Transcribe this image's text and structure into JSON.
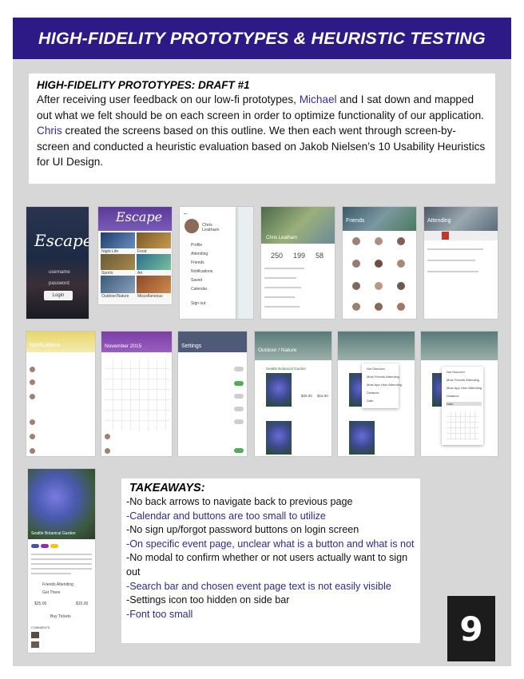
{
  "banner": {
    "title": "HIGH-FIDELITY PROTOTYPES & HEURISTIC TESTING"
  },
  "intro": {
    "heading": "HIGH-FIDELITY PROTOTYPES: DRAFT #1",
    "t1": "After receiving user feedback on our low-fi prototypes, ",
    "name1": "Michael",
    "t2": " and I sat down and mapped out what we felt should be on each screen in order to optimize functionality of our application. ",
    "name2": "Chris",
    "t3": " created the screens based on this outline. We then each went through screen-by-screen and conducted a heuristic evaluation based on Jakob Nielsen’s 10 Usability Heuristics for UI Design."
  },
  "screens": {
    "login": {
      "logo": "Escape",
      "username": "username",
      "password": "password",
      "button": "Login"
    },
    "home": {
      "logo": "Escape",
      "tiles": [
        "Night Life",
        "Food",
        "Sports",
        "Art",
        "Outdoor/Nature",
        "Miscellaneous"
      ]
    },
    "menu": {
      "name": "Chris Leatham",
      "items": [
        "Profile",
        "Attending",
        "Friends",
        "Notifications",
        "Saved",
        "Calendar",
        "Sign out"
      ]
    },
    "profile": {
      "name": "Chris Leatham",
      "stats": [
        "250",
        "199",
        "58"
      ]
    },
    "friends": {
      "title": "Friends"
    },
    "attending": {
      "title": "Attending"
    },
    "notifications": {
      "title": "Notifications"
    },
    "calendar": {
      "title": "November 2015"
    },
    "settings": {
      "title": "Settings"
    },
    "outdoor": {
      "title": "Outdoor / Nature",
      "event": "Seattle Botanical Garden",
      "price": "$25.00",
      "alt_price": "$15.00"
    },
    "dropdown1": {
      "options": [
        "Not Discover",
        "Most Friends Attending",
        "Most App User Attending",
        "Distance",
        "Date"
      ]
    },
    "dropdown2": {
      "options": [
        "Not Discover",
        "Most Friends Attending",
        "Most App User Attending",
        "Distance",
        "Date"
      ]
    },
    "event": {
      "title": "Seattle Botanical Garden",
      "friends": "Friends Attending",
      "get_there": "Get There",
      "price": "$25.00",
      "alt_price": "$15.00",
      "buy": "Buy Tickets",
      "comments": "COMMENTS"
    }
  },
  "takeaways": {
    "title": "TAKEAWAYS:",
    "items": [
      "-No back arrows to navigate back to previous page",
      "-Calendar and buttons are too small to utilize",
      "-No sign up/forgot password buttons on login screen",
      "-On specific event page, unclear what is a button and what is not",
      "-No modal to confirm whether or not users actually want to sign out",
      "-Search bar and chosen event page text is not easily visible",
      "-Settings icon too hidden on side bar",
      "-Font too small"
    ]
  },
  "page_number": "9",
  "colors": {
    "banner": "#2e1a87",
    "accent": "#3a2a9a",
    "app_purple": "#7a3ea6",
    "app_slate": "#4e5a78"
  }
}
